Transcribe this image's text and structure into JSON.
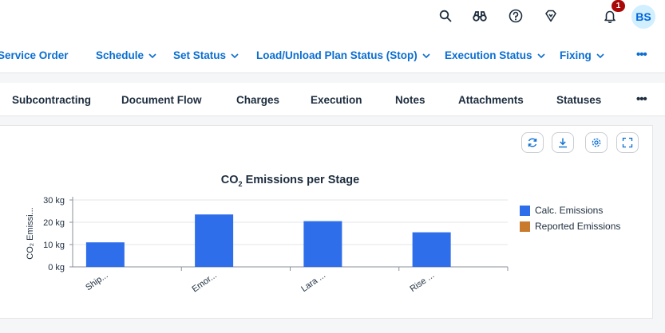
{
  "shell": {
    "icons": [
      "search-icon",
      "binoculars-icon",
      "help-icon",
      "diamond-icon",
      "bell-icon"
    ],
    "notification_count": "1",
    "avatar_initials": "BS"
  },
  "actions": {
    "items": [
      {
        "label": "Service Order",
        "has_menu": false
      },
      {
        "label": "Schedule",
        "has_menu": true
      },
      {
        "label": "Set Status",
        "has_menu": true
      },
      {
        "label": "Load/Unload Plan Status (Stop)",
        "has_menu": true
      },
      {
        "label": "Execution Status",
        "has_menu": true
      },
      {
        "label": "Fixing",
        "has_menu": true
      }
    ],
    "more_label": "•••"
  },
  "tabs": {
    "items": [
      "Subcontracting",
      "Document Flow",
      "Charges",
      "Execution",
      "Notes",
      "Attachments",
      "Statuses"
    ],
    "more_label": "•••"
  },
  "card_toolbar": [
    "refresh-icon",
    "download-icon",
    "settings-icon",
    "fullscreen-icon"
  ],
  "chart": {
    "title_prefix": "CO",
    "title_subscript": "2",
    "title_suffix": " Emissions per Stage",
    "ylabel": "CO₂ Emissi...",
    "legend": [
      {
        "label": "Calc. Emissions",
        "color": "#2e6eea"
      },
      {
        "label": "Reported Emissions",
        "color": "#c87b2c"
      }
    ]
  },
  "chart_data": {
    "type": "bar",
    "title": "CO₂ Emissions per Stage",
    "ylabel": "CO₂ Emissi...",
    "categories": [
      "Ship...",
      "Emor...",
      "Lara ...",
      "Rise ..."
    ],
    "series": [
      {
        "name": "Calc. Emissions",
        "color": "#2e6eea",
        "values": [
          11,
          23.5,
          20.5,
          15.5
        ]
      },
      {
        "name": "Reported Emissions",
        "color": "#c87b2c",
        "values": [
          0,
          0,
          0,
          0
        ]
      }
    ],
    "yticks": [
      "0 kg",
      "10 kg",
      "20 kg",
      "30 kg"
    ],
    "ylim": [
      0,
      30
    ],
    "grid": true,
    "legend_position": "right"
  }
}
